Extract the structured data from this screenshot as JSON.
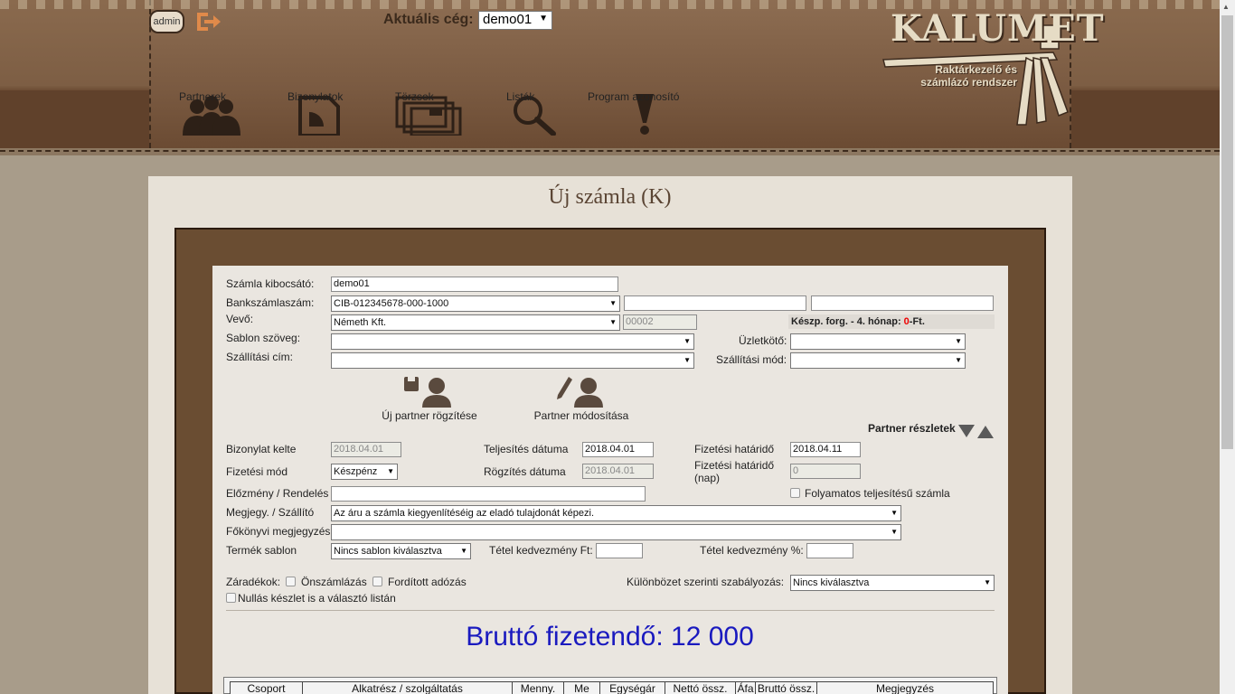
{
  "header": {
    "admin_label": "admin",
    "company_label": "Aktuális cég:",
    "company_value": "demo01",
    "nav": [
      {
        "label": "Partnerek",
        "icon": "people-icon"
      },
      {
        "label": "Bizonylatok",
        "icon": "document-icon"
      },
      {
        "label": "Törzsek",
        "icon": "folders-icon"
      },
      {
        "label": "Listák",
        "icon": "magnifier-icon"
      },
      {
        "label": "Program azonosító",
        "icon": "exclamation-icon"
      }
    ],
    "logo_title": "KALUMET",
    "logo_subtitle_1": "Raktárkezelő és",
    "logo_subtitle_2": "számlázó rendszer"
  },
  "page": {
    "title": "Új számla (K)"
  },
  "form": {
    "issuer_label": "Számla kibocsátó:",
    "issuer_value": "demo01",
    "bank_label": "Bankszámlaszám:",
    "bank_value": "CIB-012345678-000-1000",
    "buyer_label": "Vevő:",
    "buyer_value": "Németh Kft.",
    "buyer_code": "00002",
    "info_prefix": "Készp. forg. - 4. hónap: ",
    "info_amount": "0",
    "info_suffix": "-Ft.",
    "template_text_label": "Sablon szöveg:",
    "shipping_address_label": "Szállítási cím:",
    "dealer_label": "Üzletkötő:",
    "shipping_mode_label": "Szállítási mód:",
    "new_partner_label": "Új partner rögzítése",
    "edit_partner_label": "Partner módosítása",
    "partner_details_label": "Partner részletek",
    "doc_date_label": "Bizonylat kelte",
    "doc_date_value": "2018.04.01",
    "fulfil_date_label": "Teljesítés dátuma",
    "fulfil_date_value": "2018.04.01",
    "due_date_label": "Fizetési határidő",
    "due_date_value": "2018.04.11",
    "pay_mode_label": "Fizetési mód",
    "pay_mode_value": "Készpénz",
    "record_date_label": "Rögzítés dátuma",
    "record_date_value": "2018.04.01",
    "due_days_label_1": "Fizetési határidő",
    "due_days_label_2": "(nap)",
    "due_days_value": "0",
    "prior_label": "Előzmény / Rendelés",
    "continuous_label": "Folyamatos teljesítésű számla",
    "note_label": "Megjegy. / Szállító",
    "note_value": "Az áru a számla kiegyenlítéséig az eladó tulajdonát képezi.",
    "ledger_note_label": "Főkönyvi megjegyzés",
    "product_template_label": "Termék sablon",
    "product_template_value": "Nincs sablon kiválasztva",
    "item_discount_ft_label": "Tétel kedvezmény Ft:",
    "item_discount_pct_label": "Tétel kedvezmény %:",
    "clauses_label": "Záradékok:",
    "self_billing_label": "Önszámlázás",
    "reverse_tax_label": "Fordított adózás",
    "diff_regulation_label": "Különbözet szerinti szabályozás:",
    "diff_regulation_value": "Nincs kiválasztva",
    "zero_stock_label": "Nullás készlet is a választó listán"
  },
  "total": {
    "label": "Bruttó fizetendő: 12 000"
  },
  "table": {
    "headers": [
      "Csoport",
      "Alkatrész / szolgáltatás",
      "Menny.",
      "Me",
      "Egységár",
      "Nettó össz.",
      "Áfa",
      "Bruttó össz.",
      "Megjegyzés"
    ]
  },
  "colors": {
    "accent_brown": "#6a4d32",
    "total_blue": "#1a1abf",
    "info_red": "#e00000"
  }
}
